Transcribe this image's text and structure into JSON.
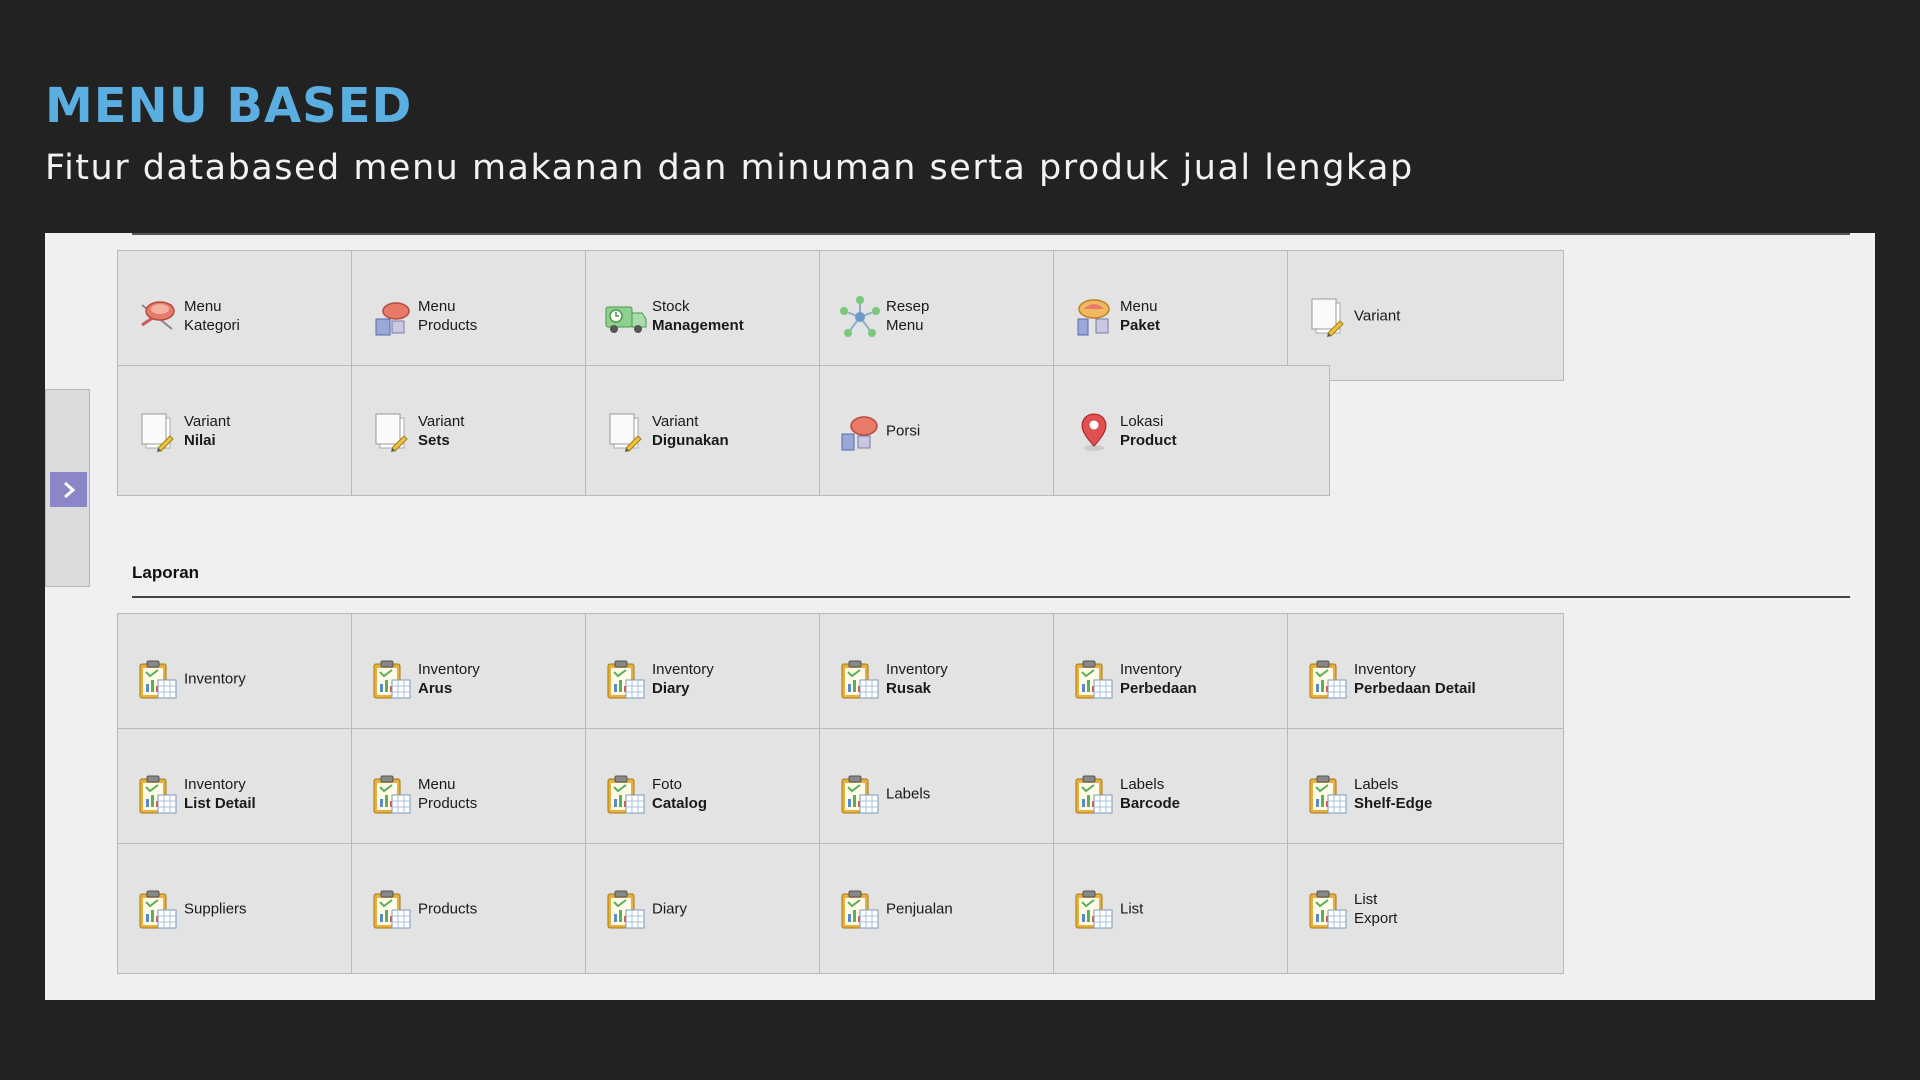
{
  "header": {
    "title": "MENU BASED",
    "subtitle": "Fitur databased menu makanan dan minuman serta produk jual lengkap"
  },
  "colors": {
    "title": "#5aaee0",
    "expand_button": "#8b86c8",
    "tile_bg": "#e3e3e3"
  },
  "sidebar": {
    "expand_icon": "chevron-right-icon"
  },
  "master_tiles": [
    {
      "line1": "Menu",
      "line2": "Kategori",
      "bold2": false,
      "icon": "food-category-icon"
    },
    {
      "line1": "Menu",
      "line2": "Products",
      "bold2": false,
      "icon": "food-products-icon"
    },
    {
      "line1": "Stock",
      "line2": "Management",
      "bold2": true,
      "icon": "delivery-truck-icon"
    },
    {
      "line1": "Resep",
      "line2": "Menu",
      "bold2": false,
      "icon": "network-icon"
    },
    {
      "line1": "Menu",
      "line2": "Paket",
      "bold2": true,
      "icon": "food-package-icon"
    },
    {
      "line1": "Variant",
      "line2": "",
      "bold2": false,
      "icon": "document-edit-icon"
    },
    {
      "line1": "Variant",
      "line2": "Nilai",
      "bold2": true,
      "icon": "document-edit-icon"
    },
    {
      "line1": "Variant",
      "line2": "Sets",
      "bold2": true,
      "icon": "document-edit-icon"
    },
    {
      "line1": "Variant",
      "line2": "Digunakan",
      "bold2": true,
      "icon": "document-edit-icon"
    },
    {
      "line1": "Porsi",
      "line2": "",
      "bold2": false,
      "icon": "food-portion-icon"
    },
    {
      "line1": "Lokasi",
      "line2": "Product",
      "bold2": true,
      "icon": "map-pin-icon"
    }
  ],
  "laporan": {
    "label": "Laporan",
    "tiles": [
      {
        "line1": "Inventory",
        "line2": "",
        "bold2": false
      },
      {
        "line1": "Inventory",
        "line2": "Arus",
        "bold2": true
      },
      {
        "line1": "Inventory",
        "line2": "Diary",
        "bold2": true
      },
      {
        "line1": "Inventory",
        "line2": "Rusak",
        "bold2": true
      },
      {
        "line1": "Inventory",
        "line2": "Perbedaan",
        "bold2": true
      },
      {
        "line1": "Inventory",
        "line2": "Perbedaan Detail",
        "bold2": true
      },
      {
        "line1": "Inventory",
        "line2": "List Detail",
        "bold2": true
      },
      {
        "line1": "Menu",
        "line2": "Products",
        "bold2": false
      },
      {
        "line1": "Foto",
        "line2": "Catalog",
        "bold2": true
      },
      {
        "line1": "Labels",
        "line2": "",
        "bold2": false
      },
      {
        "line1": "Labels",
        "line2": "Barcode",
        "bold2": true
      },
      {
        "line1": "Labels",
        "line2": "Shelf-Edge",
        "bold2": true
      },
      {
        "line1": "Suppliers",
        "line2": "",
        "bold2": false
      },
      {
        "line1": "Products",
        "line2": "",
        "bold2": false
      },
      {
        "line1": "Diary",
        "line2": "",
        "bold2": false
      },
      {
        "line1": "Penjualan",
        "line2": "",
        "bold2": false
      },
      {
        "line1": "List",
        "line2": "",
        "bold2": false
      },
      {
        "line1": "List",
        "line2": "Export",
        "bold2": false
      }
    ],
    "tile_icon": "report-clipboard-icon"
  }
}
